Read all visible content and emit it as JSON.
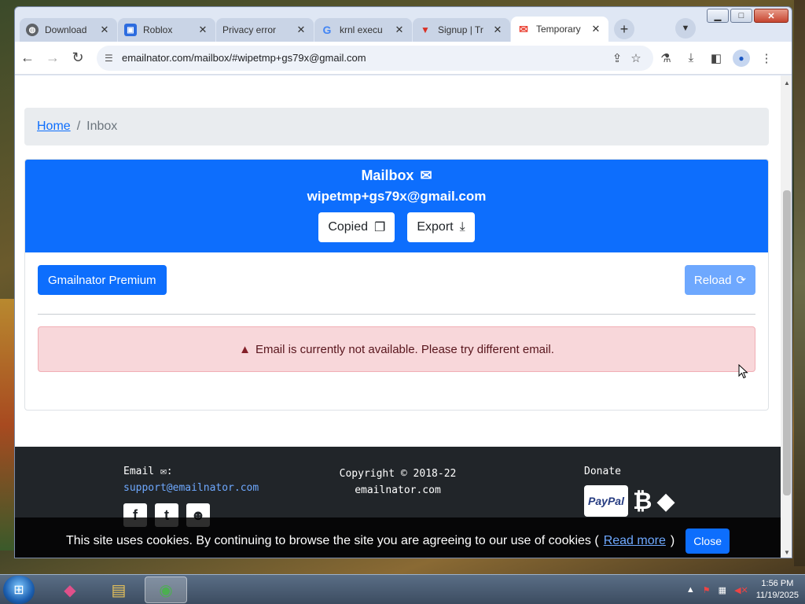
{
  "browser": {
    "tabs": [
      {
        "title": "Download",
        "favicon": "globe-icon",
        "color": "#5f6368",
        "active": false
      },
      {
        "title": "Roblox",
        "favicon": "roblox-icon",
        "color": "#2d6cdf",
        "active": false
      },
      {
        "title": "Privacy error",
        "favicon": "none",
        "color": "#c9d4e6",
        "active": false
      },
      {
        "title": "krnl execu",
        "favicon": "google-icon",
        "color": "#4285f4",
        "active": false
      },
      {
        "title": "Signup | Tr",
        "favicon": "brand-icon",
        "color": "#d93025",
        "active": false
      },
      {
        "title": "Temporary",
        "favicon": "gmail-icon",
        "color": "#ea4335",
        "active": true
      }
    ],
    "url": "emailnator.com/mailbox/#wipetmp+gs79x@gmail.com",
    "window_buttons": {
      "minimize": "▁",
      "maximize": "□",
      "close": "✕"
    }
  },
  "page": {
    "breadcrumb": {
      "home": "Home",
      "separator": "/",
      "current": "Inbox"
    },
    "mailbox": {
      "title": "Mailbox",
      "address": "wipetmp+gs79x@gmail.com",
      "copied_label": "Copied",
      "export_label": "Export"
    },
    "premium_label": "Gmailnator Premium",
    "reload_label": "Reload",
    "alert_text": "Email is currently not available. Please try different email.",
    "footer": {
      "email_label": "Email",
      "email_colon": ":",
      "support_email": "support@emailnator.com",
      "copyright_line1": "Copyright © 2018-22",
      "copyright_line2": "emailnator.com",
      "donate_label": "Donate",
      "paypal_label": "PayPal"
    },
    "cookie": {
      "text": "This site uses cookies. By continuing to browse the site you are agreeing to our use of cookies (",
      "link": "Read more",
      "after": ")",
      "close": "Close"
    }
  },
  "taskbar": {
    "time": "1:56 PM",
    "date": "11/19/2025"
  },
  "colors": {
    "primary": "#0d6efd",
    "reload": "#6ea8fe",
    "alert_bg": "#f8d7da",
    "footer_bg": "#212529"
  }
}
